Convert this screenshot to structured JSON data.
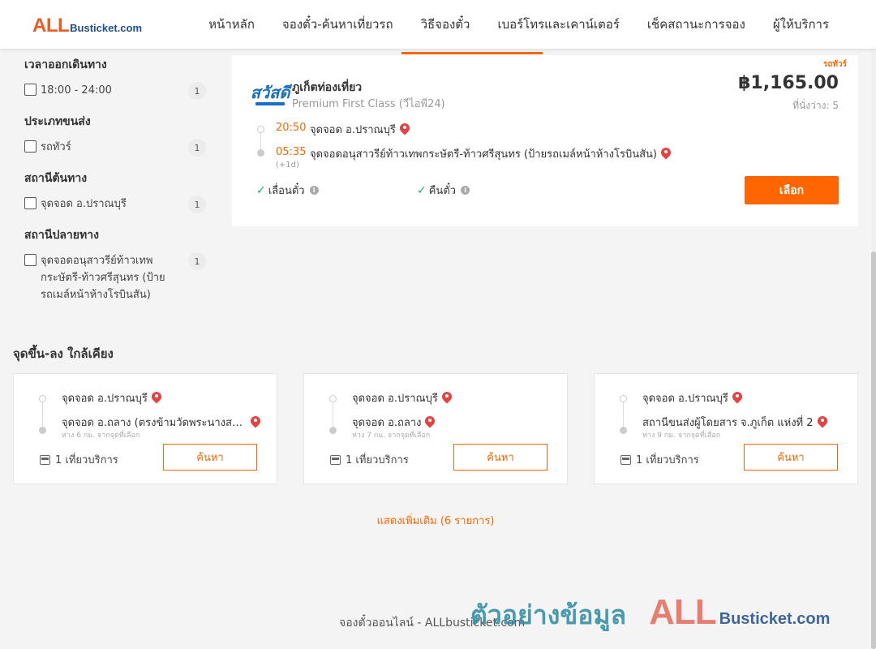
{
  "header": {
    "logo_all": "ALL",
    "logo_site": "Busticket.com",
    "nav": [
      "หน้าหลัก",
      "จองตั๋ว-ค้นหาเที่ยวรถ",
      "วิธีจองตั๋ว",
      "เบอร์โทรและเคาน์เตอร์",
      "เช็คสถานะการจอง",
      "ผู้ให้บริการ"
    ],
    "active_nav": "วิธีจองตั๋ว"
  },
  "sidebar": {
    "filters": [
      {
        "title": "เวลาออกเดินทาง",
        "option": "18:00 - 24:00",
        "count": "1"
      },
      {
        "title": "ประเภทขนส่ง",
        "option": "รถทัวร์",
        "count": "1"
      },
      {
        "title": "สถานีต้นทาง",
        "option": "จุดจอด อ.ปราณบุรี",
        "count": "1"
      },
      {
        "title": "สถานีปลายทาง",
        "option": "จุดจอดอนุสาวรีย์ท้าวเทพกระษัตรี-ท้าวศรีสุนทร (ป้ายรถเมล์หน้าห้างโรบินสัน)",
        "count": "1"
      }
    ]
  },
  "trip": {
    "badge": "รถทัวร์",
    "operator_logo_text": "สวัสดี",
    "operator": "ภูเก็ตท่องเที่ยว",
    "class": "Premium First Class (วีไอพี24)",
    "price": "฿1,165.00",
    "seats": "ที่นั่งว่าง: 5",
    "depart_time": "20:50",
    "depart_stop": "จุดจอด อ.ปราณบุรี",
    "arrive_time": "05:35",
    "arrive_stop": "จุดจอดอนุสาวรีย์ท้าวเทพกระษัตรี-ท้าวศรีสุนทร (ป้ายรถเมล์หน้าห้างโรบินสัน)",
    "plus_day": "(+1d)",
    "features": [
      "เลื่อนตั๋ว",
      "คืนตั๋ว"
    ],
    "select_label": "เลือก"
  },
  "nearby": {
    "title": "จุดขึ้น-ลง ใกล้เคียง",
    "cards": [
      {
        "from": "จุดจอด อ.ปราณบุรี",
        "to": "จุดจอด อ.ถลาง (ตรงข้ามวัดพระนางสร้าง)",
        "distance": "ห่าง 6 กม. จากจุดที่เลือก",
        "trips": "1 เที่ยวบริการ",
        "button": "ค้นหา"
      },
      {
        "from": "จุดจอด อ.ปราณบุรี",
        "to": "จุดจอด อ.ถลาง",
        "distance": "ห่าง 7 กม. จากจุดที่เลือก",
        "trips": "1 เที่ยวบริการ",
        "button": "ค้นหา"
      },
      {
        "from": "จุดจอด อ.ปราณบุรี",
        "to": "สถานีขนส่งผู้โดยสาร จ.ภูเก็ต แห่งที่ 2",
        "distance": "ห่าง 9 กม. จากจุดที่เลือก",
        "trips": "1 เที่ยวบริการ",
        "button": "ค้นหา"
      }
    ],
    "show_more": "แสดงเพิ่มเติม (6 รายการ)"
  },
  "footer": {
    "text": "จองตั๋วออนไลน์ - ALLbusticket.com",
    "watermark_text": "ตัวอย่างข้อมูล",
    "watermark_all": "ALL",
    "watermark_site": "Busticket.com"
  },
  "colors": {
    "accent": "#ff6600",
    "pin": "#e94040",
    "check": "#27ae60"
  }
}
